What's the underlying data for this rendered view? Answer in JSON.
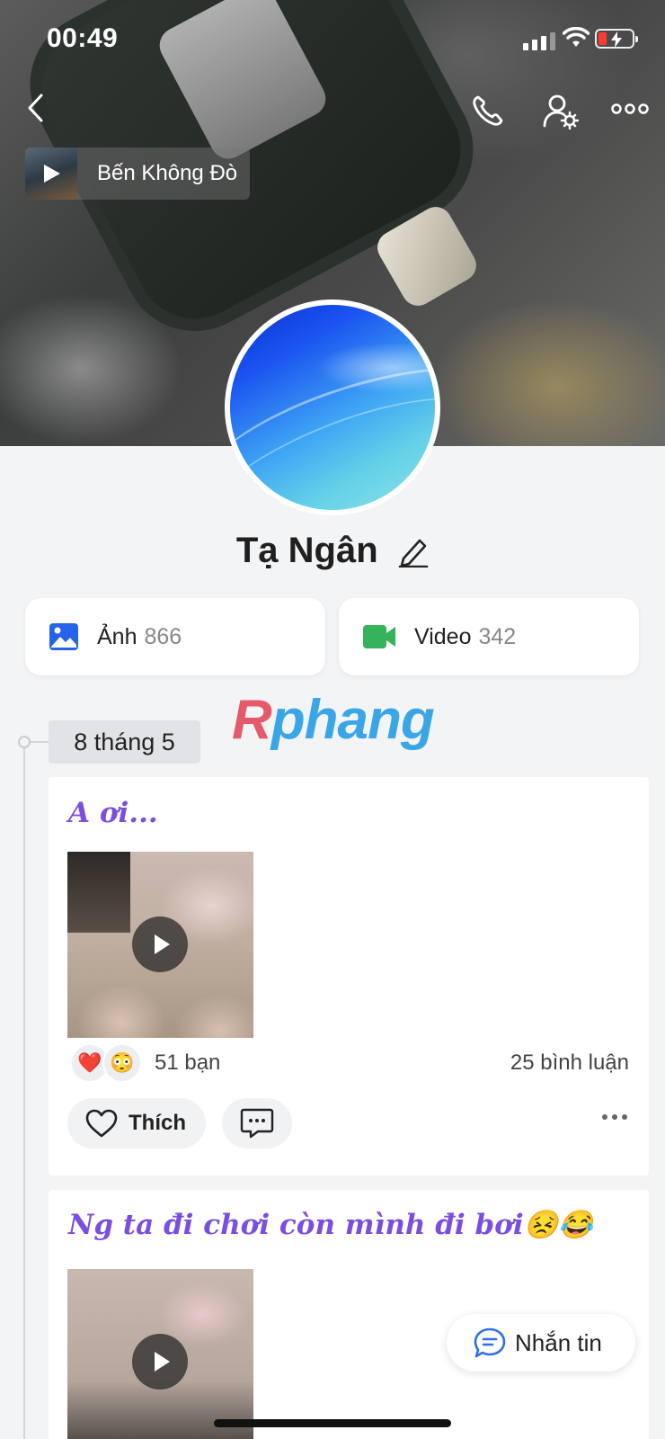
{
  "status_bar": {
    "time": "00:49"
  },
  "header": {
    "music": {
      "title": "Bến Không Đò"
    }
  },
  "profile": {
    "name": "Tạ Ngân",
    "media": [
      {
        "label": "Ảnh",
        "count": "866",
        "icon": "image-icon",
        "color": "#2563eb"
      },
      {
        "label": "Video",
        "count": "342",
        "icon": "video-icon",
        "color": "#34b35a"
      }
    ]
  },
  "watermark": {
    "part1": "R",
    "part2": "phang"
  },
  "timeline": {
    "date": "8 tháng 5",
    "posts": [
      {
        "caption": "A ơi...",
        "reactions": [
          "❤️",
          "😳"
        ],
        "reaction_count": "51 bạn",
        "comment_count": "25 bình luận",
        "like_label": "Thích"
      },
      {
        "caption": "Ng ta đi chơi còn mình đi bơi😣😂"
      }
    ]
  },
  "fab": {
    "label": "Nhắn tin"
  },
  "colors": {
    "accent": "#7b4ee0",
    "background": "#f3f4f6",
    "link": "#2f6fe8"
  }
}
